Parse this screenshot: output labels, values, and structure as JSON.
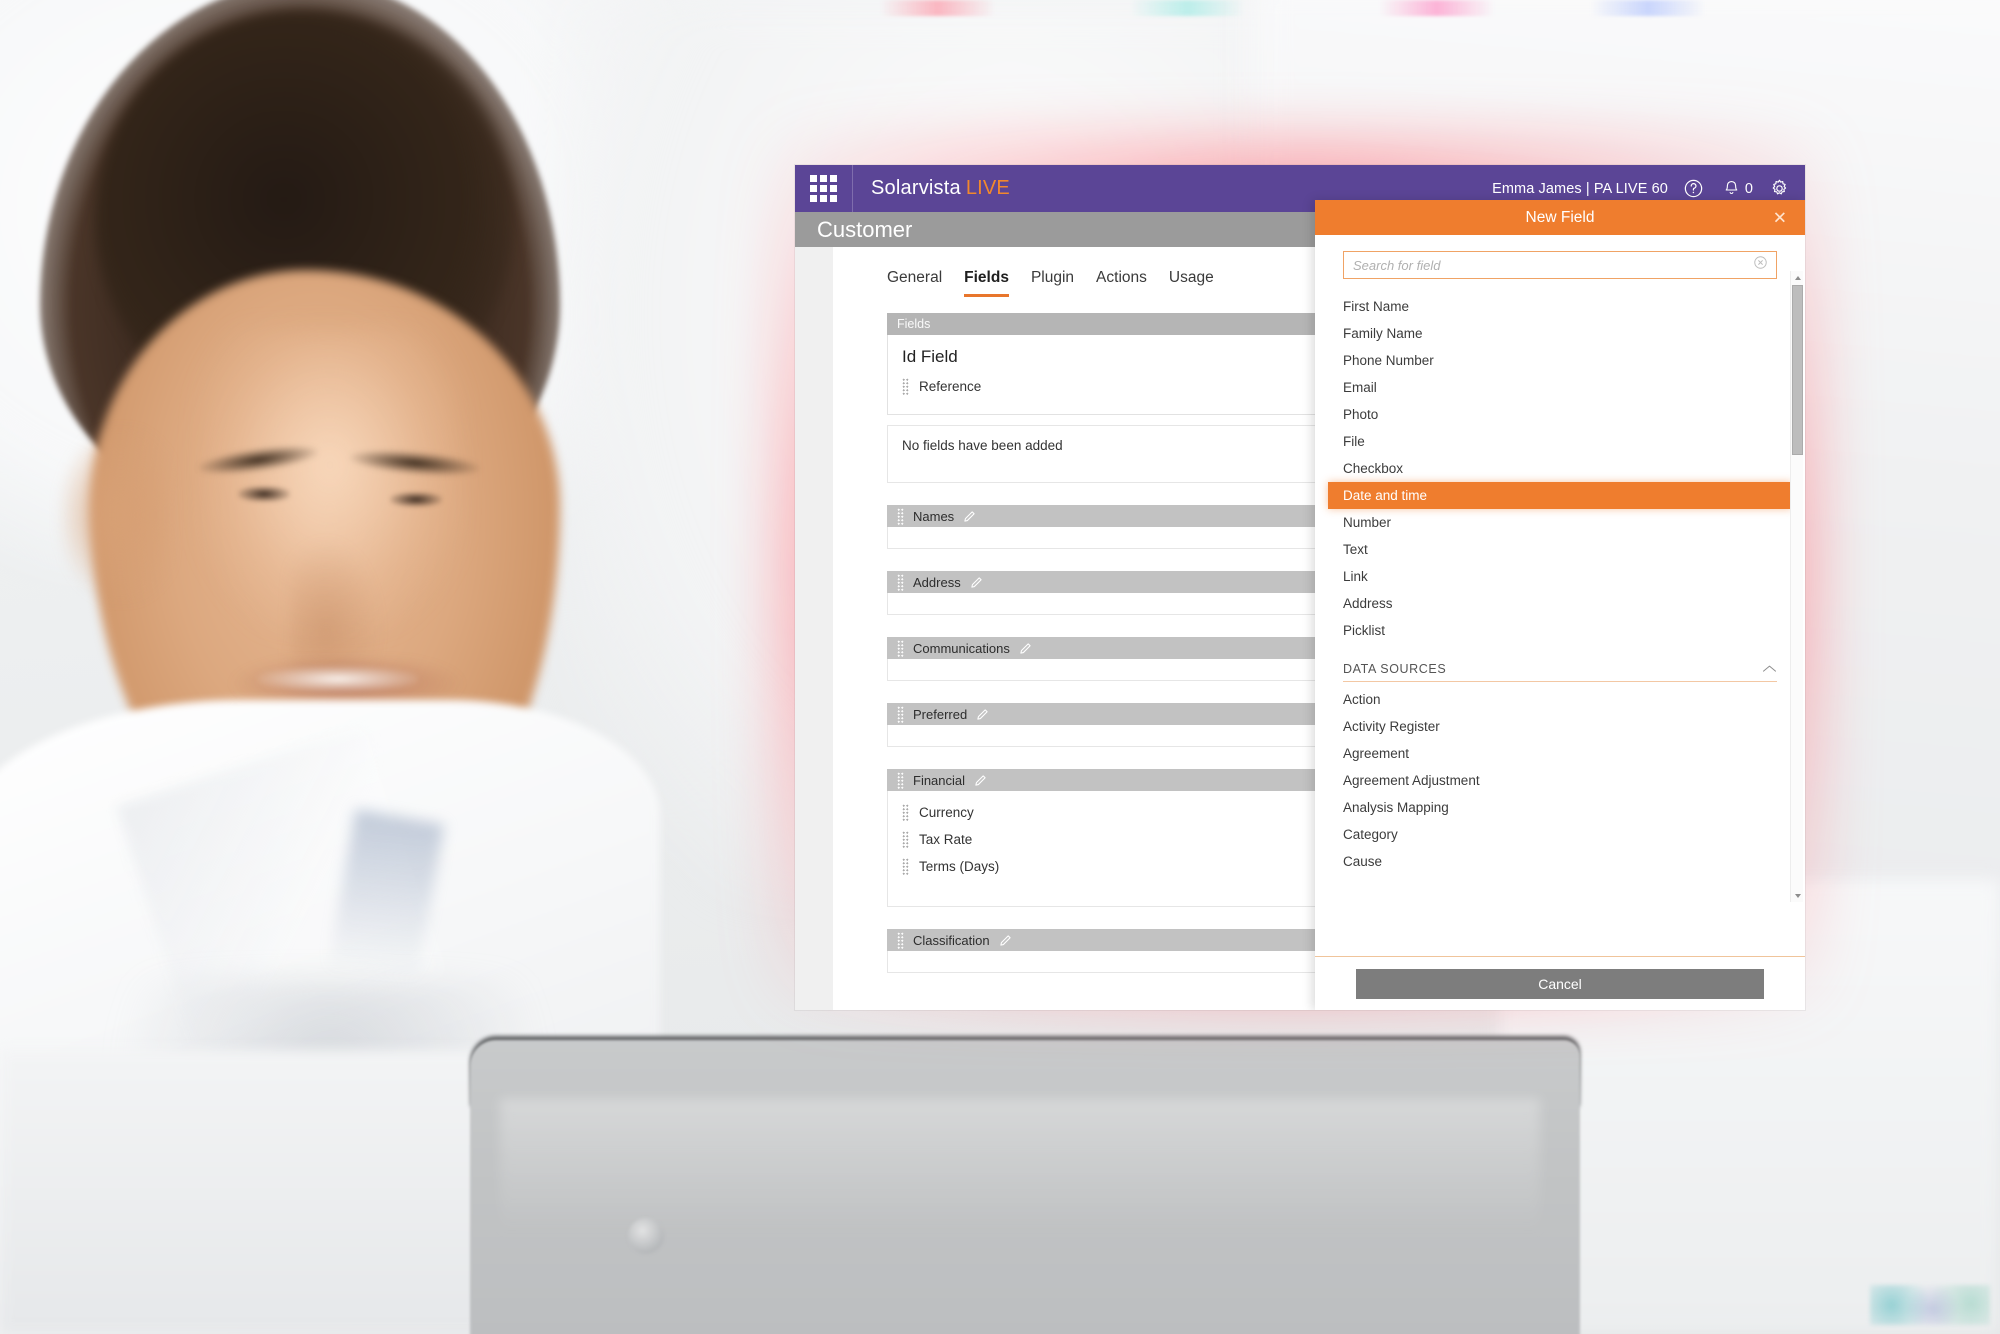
{
  "topbar": {
    "app_grid_icon": "app-grid-icon",
    "brand_name": "Solarvista",
    "brand_suffix": "LIVE",
    "user_label": "Emma James | PA LIVE 60",
    "help_icon": "help-circle-icon",
    "bell_icon": "bell-icon",
    "notification_count": "0",
    "settings_icon": "gear-icon"
  },
  "page": {
    "title": "Customer"
  },
  "tabs": [
    {
      "label": "General",
      "active": false
    },
    {
      "label": "Fields",
      "active": true
    },
    {
      "label": "Plugin",
      "active": false
    },
    {
      "label": "Actions",
      "active": false
    },
    {
      "label": "Usage",
      "active": false
    }
  ],
  "fields_panel": {
    "section_tab_label": "Fields",
    "id_field_title": "Id Field",
    "id_field_items": [
      "Reference"
    ],
    "empty_message": "No fields have been added",
    "groups": [
      {
        "name": "Names",
        "edit_icon": "pencil-icon",
        "items": []
      },
      {
        "name": "Address",
        "edit_icon": "pencil-icon",
        "items": []
      },
      {
        "name": "Communications",
        "edit_icon": "pencil-icon",
        "items": []
      },
      {
        "name": "Preferred",
        "edit_icon": "pencil-icon",
        "items": []
      },
      {
        "name": "Financial",
        "edit_icon": "pencil-icon",
        "items": [
          "Currency",
          "Tax Rate",
          "Terms (Days)"
        ]
      },
      {
        "name": "Classification",
        "edit_icon": "pencil-icon",
        "items": []
      }
    ]
  },
  "new_field": {
    "title": "New Field",
    "close_icon": "close-icon",
    "search": {
      "placeholder": "Search for field",
      "value": "",
      "clear_icon": "clear-circle-icon"
    },
    "field_types": [
      {
        "label": "First Name",
        "selected": false
      },
      {
        "label": "Family Name",
        "selected": false
      },
      {
        "label": "Phone Number",
        "selected": false
      },
      {
        "label": "Email",
        "selected": false
      },
      {
        "label": "Photo",
        "selected": false
      },
      {
        "label": "File",
        "selected": false
      },
      {
        "label": "Checkbox",
        "selected": false
      },
      {
        "label": "Date and time",
        "selected": true
      },
      {
        "label": "Number",
        "selected": false
      },
      {
        "label": "Text",
        "selected": false
      },
      {
        "label": "Link",
        "selected": false
      },
      {
        "label": "Address",
        "selected": false
      },
      {
        "label": "Picklist",
        "selected": false
      }
    ],
    "data_sources": {
      "header": "DATA SOURCES",
      "collapse_icon": "chevron-up-icon",
      "items": [
        {
          "label": "Action"
        },
        {
          "label": "Activity Register"
        },
        {
          "label": "Agreement"
        },
        {
          "label": "Agreement Adjustment"
        },
        {
          "label": "Analysis Mapping"
        },
        {
          "label": "Category"
        },
        {
          "label": "Cause"
        }
      ]
    },
    "cancel_label": "Cancel",
    "scrollbar": {
      "up_icon": "scroll-up-arrow-icon",
      "down_icon": "scroll-down-arrow-icon"
    }
  },
  "colors": {
    "brand_purple": "#5b4596",
    "accent_orange": "#ef7d2e",
    "title_gray": "#9b9b9b",
    "group_gray": "#c2c2c2",
    "cancel_gray": "#7d7d7d",
    "glow_red": "#ff465a"
  }
}
